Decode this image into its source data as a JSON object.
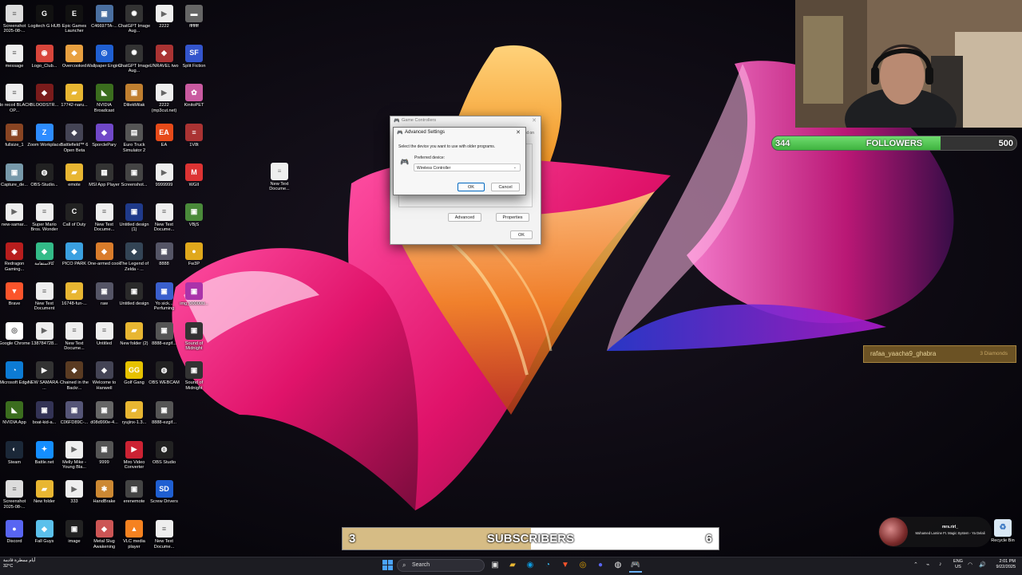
{
  "desktop_icons": [
    {
      "label": "Screenshot 2025-08-...",
      "icon": "file-icon",
      "color": "#dcdcdc"
    },
    {
      "label": "Logitech G HUB",
      "icon": "logitech-icon",
      "color": "#111"
    },
    {
      "label": "Epic Games Launcher",
      "icon": "epic-icon",
      "color": "#111"
    },
    {
      "label": "C46697TA-...",
      "icon": "image-icon",
      "color": "#4a6fa0"
    },
    {
      "label": "ChatGPT Image Aug...",
      "icon": "chatgpt-icon",
      "color": "#333"
    },
    {
      "label": "2222",
      "icon": "video-icon",
      "color": "#eee"
    },
    {
      "label": "ffffffff",
      "icon": "car-icon",
      "color": "#666"
    },
    {
      "label": "message",
      "icon": "file-icon",
      "color": "#eee"
    },
    {
      "label": "Logo_Club...",
      "icon": "logo-icon",
      "color": "#d8453b"
    },
    {
      "label": "Overcooked",
      "icon": "game-icon",
      "color": "#e8a040"
    },
    {
      "label": "Wallpaper Engine",
      "icon": "wallpaper-icon",
      "color": "#1f5fd1"
    },
    {
      "label": "ChatGPT Image Aug...",
      "icon": "chatgpt-icon",
      "color": "#333"
    },
    {
      "label": "UNRAVEL two",
      "icon": "game-icon",
      "color": "#aa3333"
    },
    {
      "label": "Split Fiction",
      "icon": "sf-icon",
      "color": "#3355cc"
    },
    {
      "label": "No recoil BLACK OP...",
      "icon": "file-icon",
      "color": "#eee"
    },
    {
      "label": "BLOODSTR...",
      "icon": "game-icon",
      "color": "#7a1b1b"
    },
    {
      "label": "17742-naru...",
      "icon": "folder-icon",
      "color": "#e8b632"
    },
    {
      "label": "NVIDIA Broadcast",
      "icon": "nvidia-icon",
      "color": "#3b6d1e"
    },
    {
      "label": "DlilekMilak",
      "icon": "image-icon",
      "color": "#c07f30"
    },
    {
      "label": "2222 (mp3cut.net)",
      "icon": "video-icon",
      "color": "#eee"
    },
    {
      "label": "KinitoPET",
      "icon": "pet-icon",
      "color": "#c95aa0"
    },
    {
      "label": "fullsize_1",
      "icon": "image-icon",
      "color": "#884422"
    },
    {
      "label": "Zoom Workplace",
      "icon": "zoom-icon",
      "color": "#2d8cff"
    },
    {
      "label": "Battlefield™ 6 Open Beta",
      "icon": "game-icon",
      "color": "#445"
    },
    {
      "label": "SporclePary",
      "icon": "game-icon",
      "color": "#7048c8"
    },
    {
      "label": "Euro Truck Simulator 2",
      "icon": "truck-icon",
      "color": "#555"
    },
    {
      "label": "EA",
      "icon": "ea-icon",
      "color": "#e64a19"
    },
    {
      "label": "1V8t",
      "icon": "file-icon",
      "color": "#a33"
    },
    {
      "label": "Capture_de...",
      "icon": "image-icon",
      "color": "#7799aa"
    },
    {
      "label": "OBS-Studio...",
      "icon": "obs-icon",
      "color": "#222"
    },
    {
      "label": "emote",
      "icon": "folder-icon",
      "color": "#e8b632"
    },
    {
      "label": "MSI App Player",
      "icon": "msi-icon",
      "color": "#333"
    },
    {
      "label": "Screenshot...",
      "icon": "image-icon",
      "color": "#444"
    },
    {
      "label": "9999999",
      "icon": "video-icon",
      "color": "#eee"
    },
    {
      "label": "WGII",
      "icon": "mario-icon",
      "color": "#d33"
    },
    {
      "label": "new-samar...",
      "icon": "video-icon",
      "color": "#eee"
    },
    {
      "label": "Super Mario Bros. Wonder",
      "icon": "file-icon",
      "color": "#eee"
    },
    {
      "label": "Call of Duty",
      "icon": "cod-icon",
      "color": "#222"
    },
    {
      "label": "New Text Docume...",
      "icon": "file-icon",
      "color": "#eee"
    },
    {
      "label": "Untitled design (1)",
      "icon": "image-icon",
      "color": "#1f3a8a"
    },
    {
      "label": "New Text Docume...",
      "icon": "file-icon",
      "color": "#eee"
    },
    {
      "label": "VBjS",
      "icon": "image-icon",
      "color": "#4a8a3a"
    },
    {
      "label": "Redragon Gaming...",
      "icon": "redragon-icon",
      "color": "#b81d1d"
    },
    {
      "label": "كالاستقامة",
      "icon": "game-icon",
      "color": "#3b8"
    },
    {
      "label": "PICO PARK",
      "icon": "game-icon",
      "color": "#3aa0e0"
    },
    {
      "label": "One-armed cook",
      "icon": "game-icon",
      "color": "#d97c2b"
    },
    {
      "label": "The Legend of Zelda - ...",
      "icon": "game-icon",
      "color": "#345"
    },
    {
      "label": "8888",
      "icon": "image-icon",
      "color": "#556"
    },
    {
      "label": "Fw3P",
      "icon": "coin-icon",
      "color": "#e0a81c"
    },
    {
      "label": "Brave",
      "icon": "brave-icon",
      "color": "#fb542b"
    },
    {
      "label": "New Text Document",
      "icon": "file-icon",
      "color": "#eee"
    },
    {
      "label": "16748-fun-...",
      "icon": "folder-icon",
      "color": "#e8b632"
    },
    {
      "label": "raw",
      "icon": "image-icon",
      "color": "#556"
    },
    {
      "label": "Untitled design",
      "icon": "image-icon",
      "color": "#2a2a2a"
    },
    {
      "label": "Yo sick... Perfuming",
      "icon": "image-icon",
      "color": "#3a5fcd"
    },
    {
      "label": "img_000000...",
      "icon": "image-icon",
      "color": "#a3a"
    },
    {
      "label": "Google Chrome",
      "icon": "chrome-icon",
      "color": "#fff"
    },
    {
      "label": "138784728...",
      "icon": "video-icon",
      "color": "#eee"
    },
    {
      "label": "New Text Docume...",
      "icon": "file-icon",
      "color": "#eee"
    },
    {
      "label": "Untitled",
      "icon": "file-icon",
      "color": "#eee"
    },
    {
      "label": "New folder (2)",
      "icon": "folder-icon",
      "color": "#e8b632"
    },
    {
      "label": "8888-ezgif...",
      "icon": "image-icon",
      "color": "#555"
    },
    {
      "label": "Sound of Midnight",
      "icon": "image-icon",
      "color": "#333"
    },
    {
      "label": "Microsoft Edge",
      "icon": "edge-icon",
      "color": "#0c7bd4"
    },
    {
      "label": "NEW SAMARA - ...",
      "icon": "video-icon",
      "color": "#333"
    },
    {
      "label": "Chained in the Backr...",
      "icon": "game-icon",
      "color": "#5a3b22"
    },
    {
      "label": "Welcome to Hanwell",
      "icon": "game-icon",
      "color": "#445"
    },
    {
      "label": "Golf Gang",
      "icon": "gg-icon",
      "color": "#e6c200"
    },
    {
      "label": "OBS WEBCAM",
      "icon": "obs-icon",
      "color": "#222"
    },
    {
      "label": "Sound of Midnight",
      "icon": "image-icon",
      "color": "#333"
    },
    {
      "label": "NVIDIA App",
      "icon": "nvidia-icon",
      "color": "#3b6d1e"
    },
    {
      "label": "boat-kid-a...",
      "icon": "image-icon",
      "color": "#335"
    },
    {
      "label": "C06FD89C-...",
      "icon": "image-icon",
      "color": "#557"
    },
    {
      "label": "d08d990e-4...",
      "icon": "image-icon",
      "color": "#666"
    },
    {
      "label": "ryujinx-1.3...",
      "icon": "folder-icon",
      "color": "#e8b632"
    },
    {
      "label": "8888-ezgif...",
      "icon": "image-icon",
      "color": "#555"
    },
    {
      "label": "",
      "icon": "blank",
      "color": "transparent"
    },
    {
      "label": "Steam",
      "icon": "steam-icon",
      "color": "#1b2838"
    },
    {
      "label": "Battle.net",
      "icon": "battlenet-icon",
      "color": "#148eff"
    },
    {
      "label": "Melly Mike - Young Bla...",
      "icon": "video-icon",
      "color": "#eee"
    },
    {
      "label": "9999",
      "icon": "image-icon",
      "color": "#555"
    },
    {
      "label": "Miro Video Converter",
      "icon": "miro-icon",
      "color": "#c23"
    },
    {
      "label": "OBS Studio",
      "icon": "obs-icon",
      "color": "#222"
    },
    {
      "label": "",
      "icon": "blank",
      "color": "transparent"
    },
    {
      "label": "Screenshot 2025-08-...",
      "icon": "file-icon",
      "color": "#dcdcdc"
    },
    {
      "label": "New folder",
      "icon": "folder-icon",
      "color": "#e8b632"
    },
    {
      "label": "333",
      "icon": "video-icon",
      "color": "#eee"
    },
    {
      "label": "HandBrake",
      "icon": "handbrake-icon",
      "color": "#c83"
    },
    {
      "label": "erenemote",
      "icon": "image-icon",
      "color": "#444"
    },
    {
      "label": "Screw Drivers",
      "icon": "sd-icon",
      "color": "#1f5fd1"
    },
    {
      "label": "",
      "icon": "blank",
      "color": "transparent"
    },
    {
      "label": "Discord",
      "icon": "discord-icon",
      "color": "#5865f2"
    },
    {
      "label": "Fall Guys",
      "icon": "game-icon",
      "color": "#5bc0eb"
    },
    {
      "label": "image",
      "icon": "image-icon",
      "color": "#222"
    },
    {
      "label": "Metal Slug Awakening",
      "icon": "game-icon",
      "color": "#c55"
    },
    {
      "label": "VLC media player",
      "icon": "vlc-icon",
      "color": "#f58220"
    },
    {
      "label": "New Text Docume...",
      "icon": "file-icon",
      "color": "#eee"
    },
    {
      "label": "",
      "icon": "blank",
      "color": "transparent"
    }
  ],
  "desktop_doc": {
    "label": "New Text Docume..."
  },
  "dialog_back": {
    "title": "Game Controllers",
    "side_text": "ed on",
    "advanced_label": "Advanced",
    "properties_label": "Properties",
    "ok_label": "OK"
  },
  "dialog_front": {
    "title": "Advanced Settings",
    "description": "Select the device you want to use with older programs.",
    "preferred_label": "Preferred device:",
    "selected_device": "Wireless Controller",
    "ok_label": "OK",
    "cancel_label": "Cancel"
  },
  "followers": {
    "current": "344",
    "label": "FOLLOWERS",
    "goal": "500",
    "progress": 0.688
  },
  "donation": {
    "user": "rafaa_yaacha9_ghabra",
    "amount": "3 Diamonds"
  },
  "subscribers": {
    "current": "3",
    "label": "SUBSCRIBERS",
    "goal": "6",
    "progress": 0.5
  },
  "now_playing": {
    "user": "mrs.rirl_",
    "song": "Mohamed Lamine Ft. Magic System - Ya Delali"
  },
  "recycle_bin": {
    "label": "Recycle Bin"
  },
  "taskbar": {
    "search_placeholder": "Search",
    "weather_text": "أيام ممطرة قادمة",
    "weather_temp": "32°C",
    "lang_top": "ENG",
    "lang_bottom": "US",
    "time": "2:01 PM",
    "date": "9/22/2025"
  }
}
